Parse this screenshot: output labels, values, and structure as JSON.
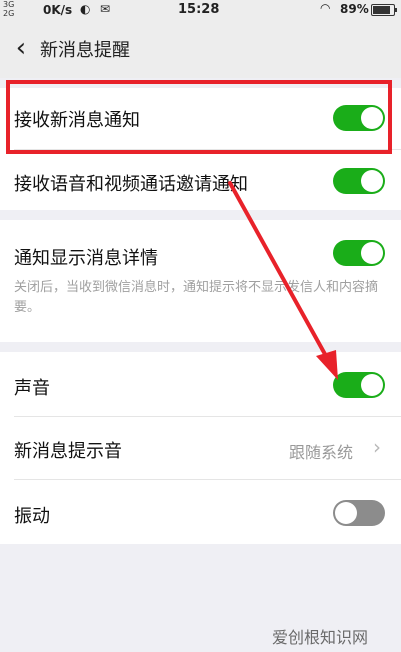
{
  "status_bar": {
    "signal_top": "3G",
    "signal_bottom": "2G",
    "network_speed": "0K/s",
    "time": "15:28",
    "battery_percent": "89%"
  },
  "nav": {
    "title": "新消息提醒"
  },
  "settings": {
    "receive_new_message": {
      "label": "接收新消息通知",
      "enabled": true
    },
    "receive_call_invite": {
      "label": "接收语音和视频通话邀请通知",
      "enabled": true
    },
    "show_message_details": {
      "label": "通知显示消息详情",
      "enabled": true,
      "description": "关闭后，当收到微信消息时，通知提示将不显示发信人和内容摘要。"
    },
    "sound": {
      "label": "声音",
      "enabled": true
    },
    "notification_tone": {
      "label": "新消息提示音",
      "value": "跟随系统"
    },
    "vibration": {
      "label": "振动",
      "enabled": false
    }
  },
  "watermark": "爱创根知识网",
  "colors": {
    "toggle_on": "#1aad19",
    "toggle_off": "#8c8c8c",
    "highlight_box": "#e8222a",
    "arrow": "#e8222a"
  }
}
